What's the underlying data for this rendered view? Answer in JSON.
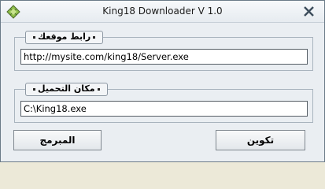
{
  "window": {
    "title": "King18 Downloader V 1.0",
    "app_icon": "diamond-grid-icon",
    "close_icon": "close-icon"
  },
  "site_group": {
    "label": "رابط موقعك",
    "url_value": "http://mysite.com/king18/Server.exe"
  },
  "path_group": {
    "label": "مكان التحميل",
    "path_value": "C:\\King18.exe"
  },
  "buttons": {
    "programmer": "المبرمج",
    "build": "تكوين"
  }
}
